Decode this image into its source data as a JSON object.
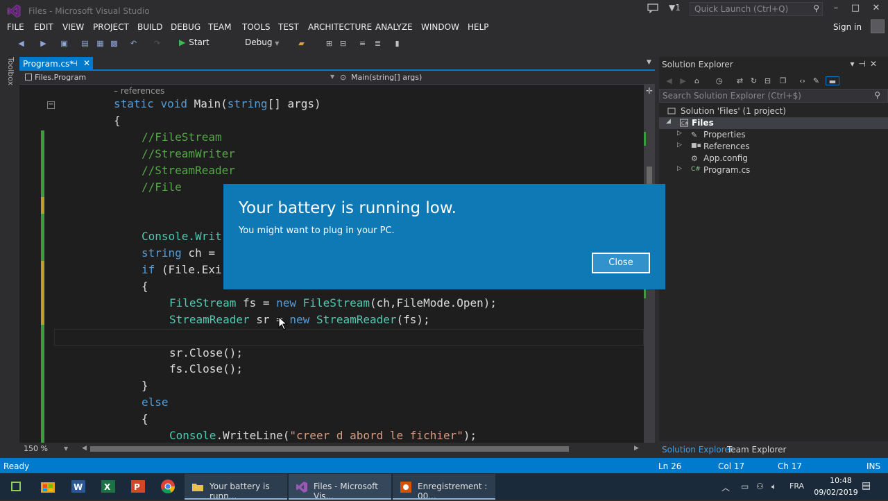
{
  "window": {
    "title": "Files - Microsoft Visual Studio"
  },
  "titlebar": {
    "notification_count": "1",
    "quick_launch_placeholder": "Quick Launch (Ctrl+Q)",
    "minimize": "–",
    "maximize": "□",
    "close": "✕"
  },
  "menu": {
    "items": [
      "FILE",
      "EDIT",
      "VIEW",
      "PROJECT",
      "BUILD",
      "DEBUG",
      "TEAM",
      "TOOLS",
      "TEST",
      "ARCHITECTURE",
      "ANALYZE",
      "WINDOW",
      "HELP"
    ],
    "sign_in": "Sign in"
  },
  "toolbar": {
    "start_label": "Start",
    "config": "Debug"
  },
  "toolbox": {
    "label": "Toolbox"
  },
  "editor": {
    "tab_label": "Program.cs*",
    "nav_class": "Files.Program",
    "nav_member": "Main(string[] args)",
    "codelens": "– references",
    "zoom": "150 %"
  },
  "solution_explorer": {
    "title": "Solution Explorer",
    "search_placeholder": "Search Solution Explorer (Ctrl+$)",
    "tree": {
      "solution": "Solution 'Files' (1 project)",
      "project": "Files",
      "properties": "Properties",
      "references": "References",
      "app_config": "App.config",
      "program": "Program.cs"
    },
    "tabs": {
      "solution": "Solution Explorer",
      "team": "Team Explorer"
    }
  },
  "status": {
    "ready": "Ready",
    "ln": "Ln 26",
    "col": "Col 17",
    "ch": "Ch 17",
    "mode": "INS"
  },
  "taskbar": {
    "tasks": [
      {
        "label": "Your battery is runn..."
      },
      {
        "label": "Files - Microsoft Vis..."
      },
      {
        "label": "Enregistrement : 00..."
      }
    ],
    "lang": "FRA",
    "time": "10:48",
    "date": "09/02/2019"
  },
  "toast": {
    "title": "Your battery is running low.",
    "body": "You might want to plug in your PC.",
    "close_label": "Close"
  },
  "colors": {
    "accent": "#007acc",
    "toast_bg": "#0f79b6",
    "editor_bg": "#1e1e1e",
    "keyword": "#569cd6",
    "comment": "#57a64a",
    "type": "#4ec9b0",
    "string": "#d69d85"
  },
  "code": {
    "l1_static": "static",
    "l1_void": "void",
    "l1_main": " Main(",
    "l1_string": "string",
    "l1_rest": "[] args)",
    "l2": "{",
    "c1": "//FileStream",
    "c2": "//StreamWriter",
    "c3": "//StreamReader",
    "c4": "//File",
    "l7": "Console.Writ",
    "l8_kw": "string",
    "l8_rest": " ch =",
    "l9_kw": "if",
    "l9_rest": " (File.Exi",
    "l10": "{",
    "l11_t1": "FileStream",
    "l11_a": " fs = ",
    "l11_new": "new",
    "l11_sp": " ",
    "l11_t2": "FileStream",
    "l11_b": "(ch,FileMode.Open);",
    "l12_t1": "StreamReader",
    "l12_a": " sr = ",
    "l12_new": "new",
    "l12_sp": " ",
    "l12_t2": "StreamReader",
    "l12_b": "(fs);",
    "l14": "sr.Close();",
    "l15": "fs.Close();",
    "l16": "}",
    "l17": "else",
    "l18": "{",
    "l19_t": "Console",
    "l19_a": ".WriteLine(",
    "l19_s": "\"creer d abord le fichier\"",
    "l19_b": ");"
  }
}
